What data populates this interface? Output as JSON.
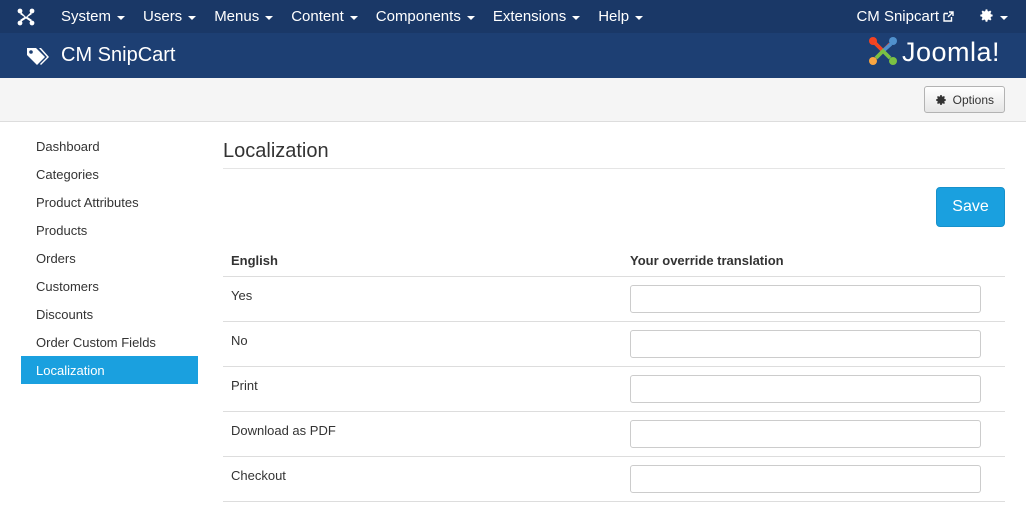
{
  "topnav": {
    "menus": [
      {
        "label": "System",
        "name": "menu-system"
      },
      {
        "label": "Users",
        "name": "menu-users"
      },
      {
        "label": "Menus",
        "name": "menu-menus"
      },
      {
        "label": "Content",
        "name": "menu-content"
      },
      {
        "label": "Components",
        "name": "menu-components"
      },
      {
        "label": "Extensions",
        "name": "menu-extensions"
      },
      {
        "label": "Help",
        "name": "menu-help"
      }
    ],
    "site_link": "CM Snipcart"
  },
  "header": {
    "title": "CM SnipCart",
    "brand": "Joomla!"
  },
  "toolbar": {
    "options_label": "Options"
  },
  "sidebar": {
    "items": [
      {
        "label": "Dashboard",
        "active": false
      },
      {
        "label": "Categories",
        "active": false
      },
      {
        "label": "Product Attributes",
        "active": false
      },
      {
        "label": "Products",
        "active": false
      },
      {
        "label": "Orders",
        "active": false
      },
      {
        "label": "Customers",
        "active": false
      },
      {
        "label": "Discounts",
        "active": false
      },
      {
        "label": "Order Custom Fields",
        "active": false
      },
      {
        "label": "Localization",
        "active": true
      }
    ]
  },
  "main": {
    "title": "Localization",
    "save_label": "Save",
    "table": {
      "headers": [
        "English",
        "Your override translation"
      ],
      "rows": [
        {
          "english": "Yes",
          "override": ""
        },
        {
          "english": "No",
          "override": ""
        },
        {
          "english": "Print",
          "override": ""
        },
        {
          "english": "Download as PDF",
          "override": ""
        },
        {
          "english": "Checkout",
          "override": ""
        }
      ]
    }
  },
  "colors": {
    "navbar": "#1a3867",
    "header": "#1d3f73",
    "accent": "#1aa0df"
  },
  "icons": {
    "joomla_logo": "joomla-logo-icon",
    "external_link": "external-link-icon",
    "settings": "gear-icon",
    "component": "tag-icon"
  }
}
